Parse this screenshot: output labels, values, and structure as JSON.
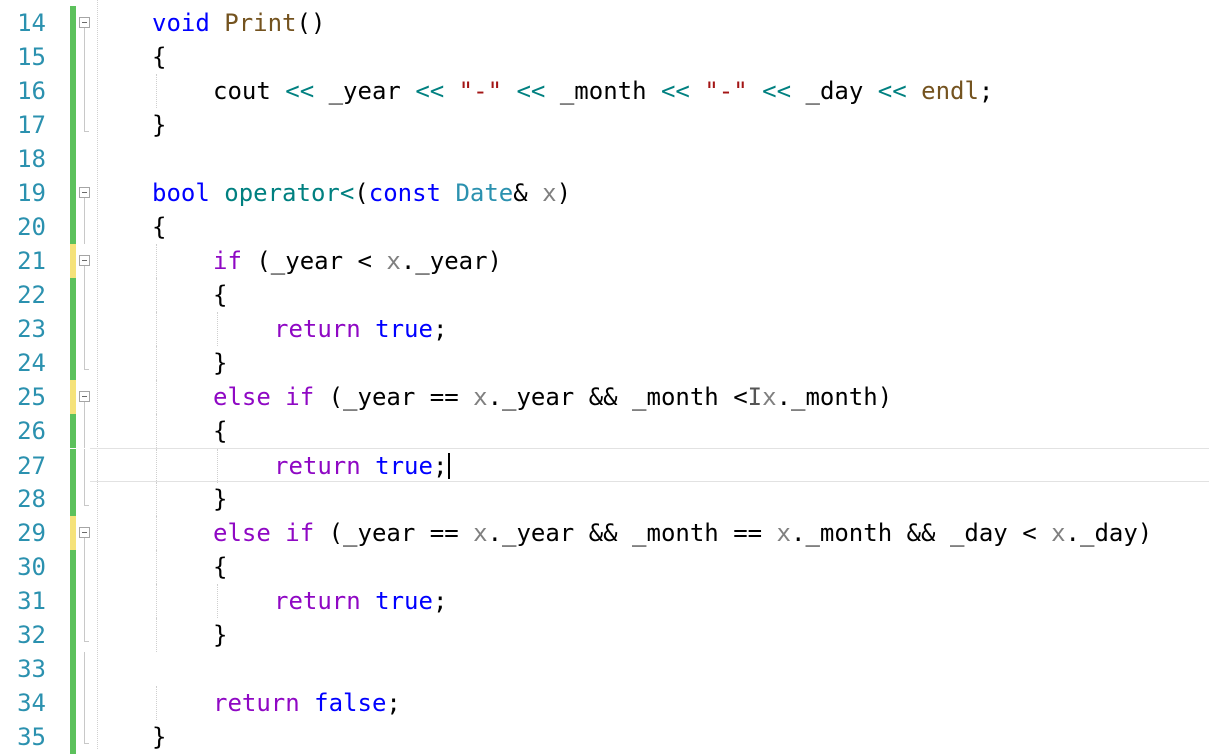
{
  "editor": {
    "lines": [
      {
        "num": "14",
        "indent": 0,
        "marker": "#5cc15c",
        "fold": "box",
        "tokens": [
          {
            "t": "void",
            "c": "kb"
          },
          {
            "t": " "
          },
          {
            "t": "Print",
            "c": "fn"
          },
          {
            "t": "()"
          }
        ]
      },
      {
        "num": "15",
        "indent": 0,
        "marker": "#5cc15c",
        "fold": "line",
        "tokens": [
          {
            "t": "{"
          }
        ]
      },
      {
        "num": "16",
        "indent": 1,
        "marker": "#5cc15c",
        "fold": "line",
        "tokens": [
          {
            "t": "cout "
          },
          {
            "t": "<<",
            "c": "op"
          },
          {
            "t": " _year "
          },
          {
            "t": "<<",
            "c": "op"
          },
          {
            "t": " "
          },
          {
            "t": "\"-\"",
            "c": "st"
          },
          {
            "t": " "
          },
          {
            "t": "<<",
            "c": "op"
          },
          {
            "t": " _month "
          },
          {
            "t": "<<",
            "c": "op"
          },
          {
            "t": " "
          },
          {
            "t": "\"-\"",
            "c": "st"
          },
          {
            "t": " "
          },
          {
            "t": "<<",
            "c": "op"
          },
          {
            "t": " _day "
          },
          {
            "t": "<<",
            "c": "op"
          },
          {
            "t": " "
          },
          {
            "t": "endl",
            "c": "fn"
          },
          {
            "t": ";"
          }
        ]
      },
      {
        "num": "17",
        "indent": 0,
        "marker": "#5cc15c",
        "fold": "end",
        "tokens": [
          {
            "t": "}"
          }
        ]
      },
      {
        "num": "18",
        "indent": 0,
        "marker": "#5cc15c",
        "fold": "",
        "tokens": []
      },
      {
        "num": "19",
        "indent": 0,
        "marker": "#5cc15c",
        "fold": "box",
        "tokens": [
          {
            "t": "bool",
            "c": "kb"
          },
          {
            "t": " "
          },
          {
            "t": "operator<",
            "c": "op"
          },
          {
            "t": "("
          },
          {
            "t": "const",
            "c": "kb"
          },
          {
            "t": " "
          },
          {
            "t": "Date",
            "c": "ty"
          },
          {
            "t": "& "
          },
          {
            "t": "x",
            "c": "pa"
          },
          {
            "t": ")"
          }
        ]
      },
      {
        "num": "20",
        "indent": 0,
        "marker": "#5cc15c",
        "fold": "line",
        "tokens": [
          {
            "t": "{"
          }
        ]
      },
      {
        "num": "21",
        "indent": 1,
        "marker": "#f5e27a",
        "fold": "box",
        "tokens": [
          {
            "t": "if",
            "c": "kw"
          },
          {
            "t": " (_year < "
          },
          {
            "t": "x",
            "c": "pa"
          },
          {
            "t": "._year)"
          }
        ]
      },
      {
        "num": "22",
        "indent": 1,
        "marker": "#5cc15c",
        "fold": "line",
        "tokens": [
          {
            "t": "{"
          }
        ]
      },
      {
        "num": "23",
        "indent": 2,
        "marker": "#5cc15c",
        "fold": "line",
        "tokens": [
          {
            "t": "return",
            "c": "kw"
          },
          {
            "t": " "
          },
          {
            "t": "true",
            "c": "kb"
          },
          {
            "t": ";"
          }
        ]
      },
      {
        "num": "24",
        "indent": 1,
        "marker": "#5cc15c",
        "fold": "end",
        "tokens": [
          {
            "t": "}"
          }
        ]
      },
      {
        "num": "25",
        "indent": 1,
        "marker": "#f5e27a",
        "fold": "box",
        "tokens": [
          {
            "t": "else",
            "c": "kw"
          },
          {
            "t": " "
          },
          {
            "t": "if",
            "c": "kw"
          },
          {
            "t": " (_year == "
          },
          {
            "t": "x",
            "c": "pa"
          },
          {
            "t": "._year && _month <"
          },
          {
            "t": "I",
            "c": "ibeam"
          },
          {
            "t": "x",
            "c": "pa"
          },
          {
            "t": "._month)"
          }
        ]
      },
      {
        "num": "26",
        "indent": 1,
        "marker": "#5cc15c",
        "fold": "line",
        "tokens": [
          {
            "t": "{"
          }
        ]
      },
      {
        "num": "27",
        "indent": 2,
        "marker": "#5cc15c",
        "fold": "line",
        "current": true,
        "caret": true,
        "tokens": [
          {
            "t": "return",
            "c": "kw"
          },
          {
            "t": " "
          },
          {
            "t": "true",
            "c": "kb"
          },
          {
            "t": ";"
          }
        ]
      },
      {
        "num": "28",
        "indent": 1,
        "marker": "#5cc15c",
        "fold": "end",
        "tokens": [
          {
            "t": "}"
          }
        ]
      },
      {
        "num": "29",
        "indent": 1,
        "marker": "#f5e27a",
        "fold": "box",
        "tokens": [
          {
            "t": "else",
            "c": "kw"
          },
          {
            "t": " "
          },
          {
            "t": "if",
            "c": "kw"
          },
          {
            "t": " (_year == "
          },
          {
            "t": "x",
            "c": "pa"
          },
          {
            "t": "._year && _month == "
          },
          {
            "t": "x",
            "c": "pa"
          },
          {
            "t": "._month && _day < "
          },
          {
            "t": "x",
            "c": "pa"
          },
          {
            "t": "._day)"
          }
        ]
      },
      {
        "num": "30",
        "indent": 1,
        "marker": "#5cc15c",
        "fold": "line",
        "tokens": [
          {
            "t": "{"
          }
        ]
      },
      {
        "num": "31",
        "indent": 2,
        "marker": "#5cc15c",
        "fold": "line",
        "tokens": [
          {
            "t": "return",
            "c": "kw"
          },
          {
            "t": " "
          },
          {
            "t": "true",
            "c": "kb"
          },
          {
            "t": ";"
          }
        ]
      },
      {
        "num": "32",
        "indent": 1,
        "marker": "#5cc15c",
        "fold": "end",
        "tokens": [
          {
            "t": "}"
          }
        ]
      },
      {
        "num": "33",
        "indent": 0,
        "marker": "#5cc15c",
        "fold": "line",
        "tokens": []
      },
      {
        "num": "34",
        "indent": 1,
        "marker": "#5cc15c",
        "fold": "line",
        "tokens": [
          {
            "t": "return",
            "c": "kw"
          },
          {
            "t": " "
          },
          {
            "t": "false",
            "c": "kb"
          },
          {
            "t": ";"
          }
        ]
      },
      {
        "num": "35",
        "indent": 0,
        "marker": "#5cc15c",
        "fold": "end",
        "tokens": [
          {
            "t": "}"
          }
        ]
      }
    ]
  }
}
